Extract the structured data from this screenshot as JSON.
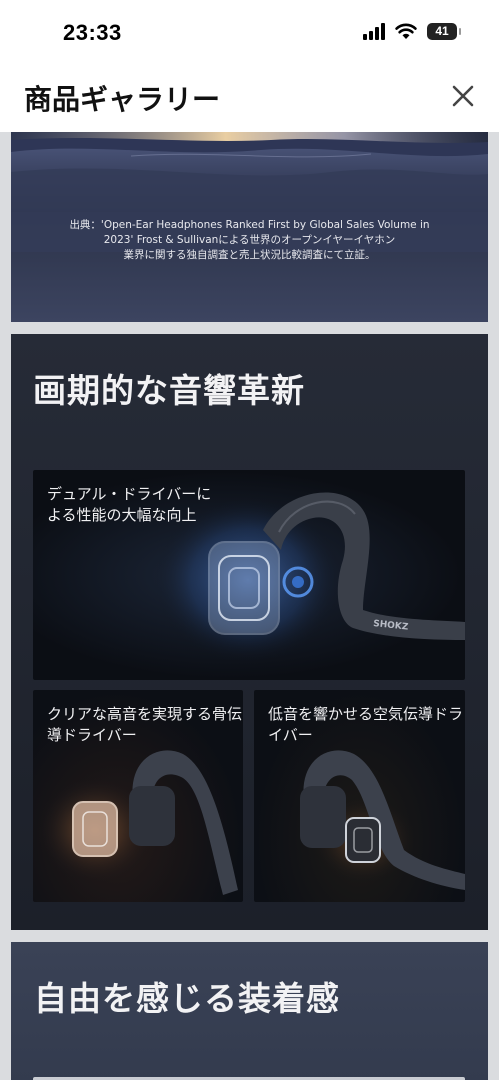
{
  "status_bar": {
    "time": "23:33",
    "battery": "41"
  },
  "header": {
    "title": "商品ギャラリー"
  },
  "source_note": {
    "line1": "出典：'Open-Ear Headphones Ranked First by Global Sales Volume in",
    "line2": "2023' Frost & Sullivanによる世界のオープンイヤーイヤホン",
    "line3": "業界に関する独自調査と売上状況比較調査にて立証。"
  },
  "audio_section": {
    "title": "画期的な音響革新",
    "cards": [
      {
        "label": "デュアル・ドライバーによる性能の大幅な向上",
        "brand": "SHOKZ"
      },
      {
        "label": "クリアな高音を実現する骨伝導ドライバー"
      },
      {
        "label": "低音を響かせる空気伝導ドライバー"
      }
    ]
  },
  "fit_section": {
    "title": "自由を感じる装着感"
  },
  "icons": {
    "close": "close-icon",
    "signal": "cellular-signal-icon",
    "wifi": "wifi-icon",
    "battery": "battery-icon"
  },
  "colors": {
    "accent_blue": "#4a7fd6",
    "warm_glow": "#d98a4a",
    "panel_dark": "#1c2029"
  }
}
